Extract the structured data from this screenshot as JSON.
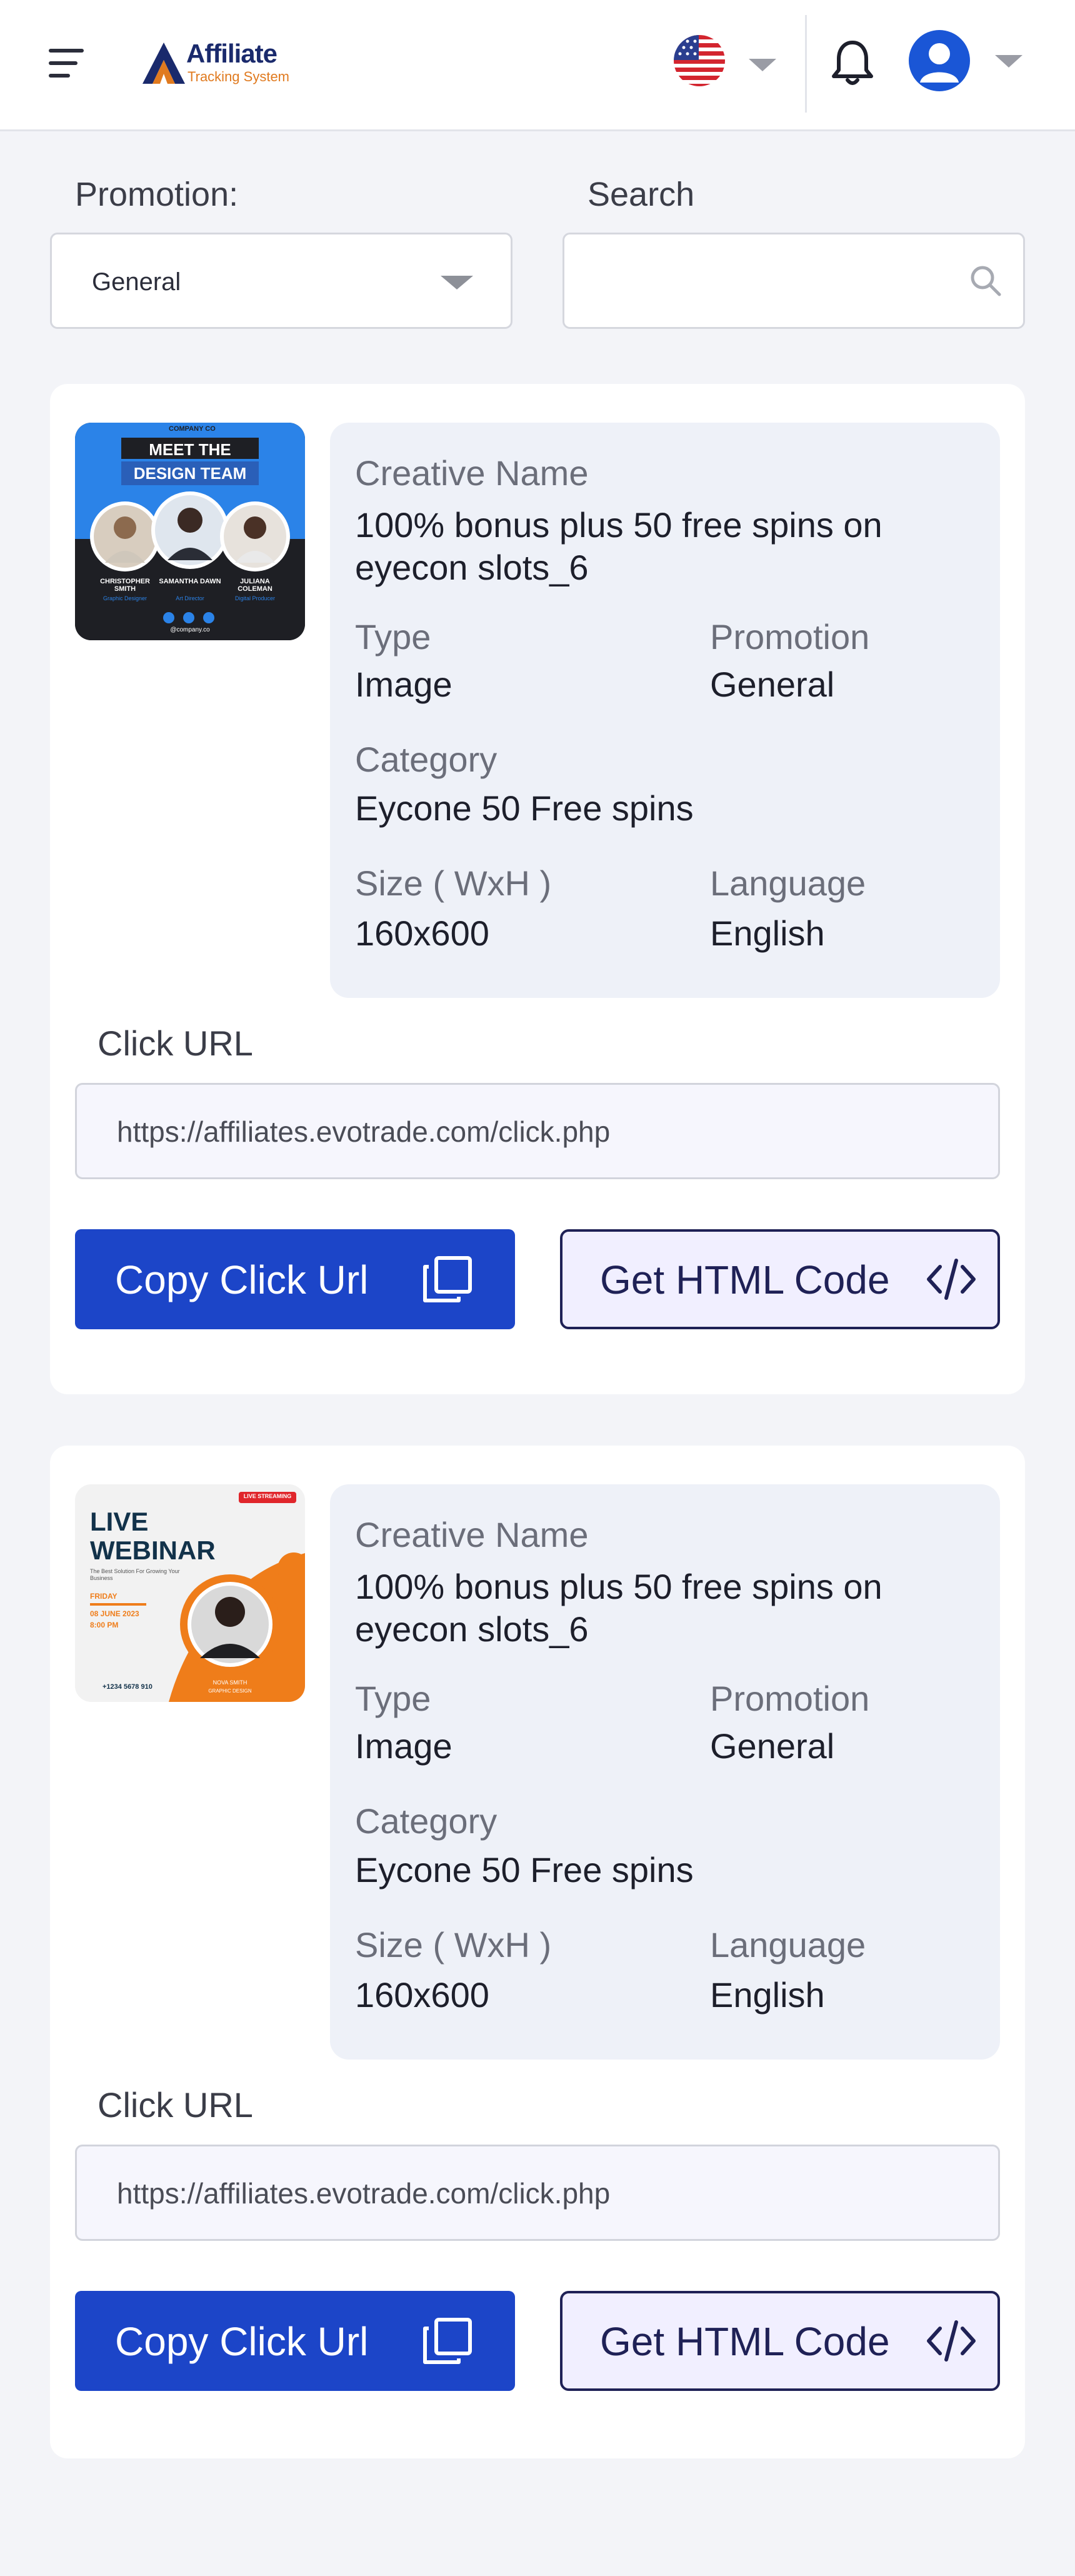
{
  "header": {
    "logo": {
      "line1": "Affiliate",
      "line2": "Tracking System"
    },
    "icons": {
      "menu": "hamburger-icon",
      "flag": "us-flag-icon",
      "notifications": "bell-icon",
      "user": "user-avatar-icon"
    }
  },
  "filters": {
    "promotion_label": "Promotion:",
    "promotion_value": "General",
    "search_label": "Search",
    "search_value": ""
  },
  "labels": {
    "creative_name": "Creative Name",
    "type": "Type",
    "promotion": "Promotion",
    "category": "Category",
    "size": "Size ( WxH )",
    "language": "Language",
    "click_url": "Click URL",
    "copy_button": "Copy Click Url",
    "html_button": "Get HTML Code"
  },
  "creatives": [
    {
      "name": "100% bonus plus 50 free spins on eyecon slots_6",
      "type": "Image",
      "promotion": "General",
      "category": "Eycone 50 Free spins",
      "size": "160x600",
      "language": "English",
      "click_url": "https://affiliates.evotrade.com/click.php",
      "banner": {
        "company": "COMPANY CO",
        "heading1": "MEET THE",
        "heading2": "DESIGN TEAM",
        "people": [
          {
            "name": "CHRISTOPHER SMITH",
            "role": "Graphic Designer"
          },
          {
            "name": "SAMANTHA DAWN",
            "role": "Art Director"
          },
          {
            "name": "JULIANA COLEMAN",
            "role": "Digital Producer"
          }
        ],
        "handle": "@company.co"
      }
    },
    {
      "name": "100% bonus plus 50 free spins on eyecon slots_6",
      "type": "Image",
      "promotion": "General",
      "category": "Eycone 50 Free spins",
      "size": "160x600",
      "language": "English",
      "click_url": "https://affiliates.evotrade.com/click.php",
      "banner": {
        "badge": "LIVE STREAMING",
        "title1": "LIVE",
        "title2": "WEBINAR",
        "tagline": "The Best Solution For Growing Your Business",
        "day": "FRIDAY",
        "date": "08 JUNE 2023",
        "time": "8:00 PM",
        "phone": "+1234 5678 910",
        "speaker_name": "NOVA SMITH",
        "speaker_role": "GRAPHIC DESIGN"
      }
    }
  ]
}
